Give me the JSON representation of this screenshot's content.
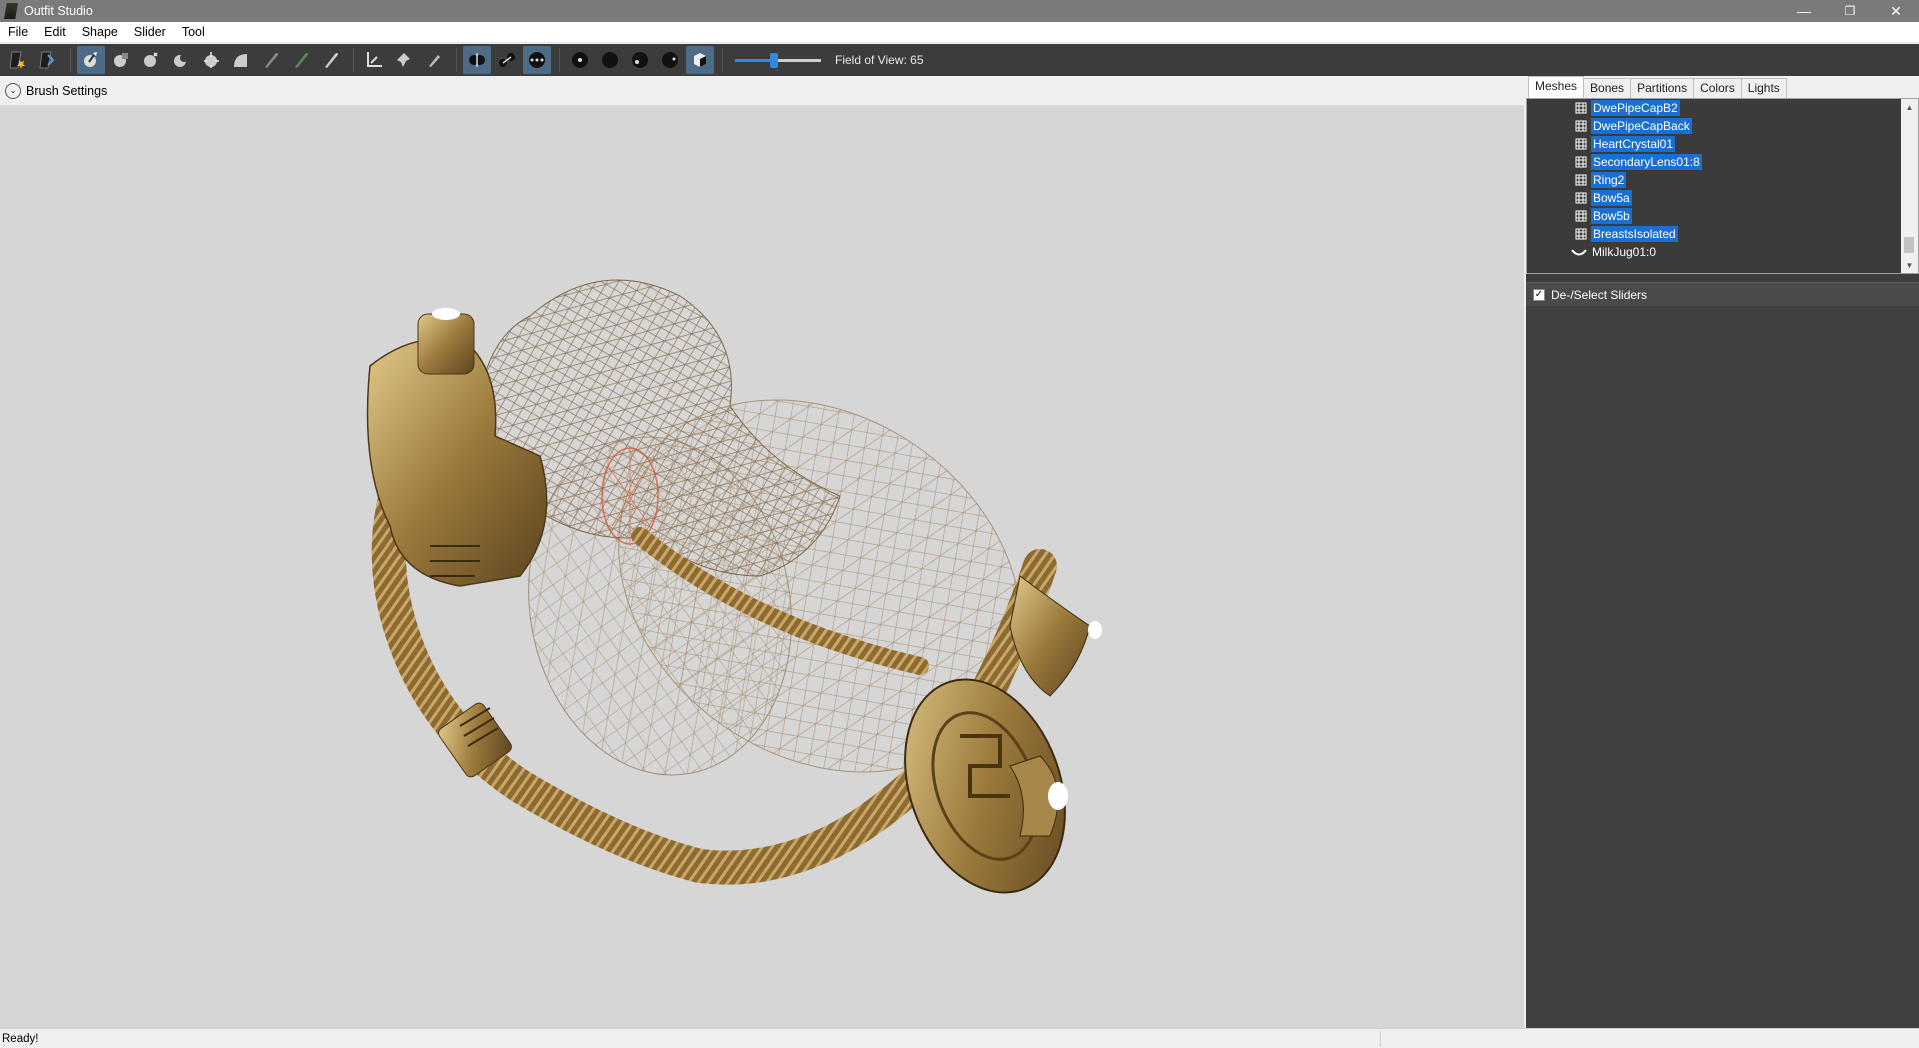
{
  "window": {
    "title": "Outfit Studio",
    "minimize_glyph": "—",
    "restore_glyph": "❐",
    "close_glyph": "✕"
  },
  "menu": [
    "File",
    "Edit",
    "Shape",
    "Slider",
    "Tool"
  ],
  "toolbar": {
    "fov_label": "Field of View: 65",
    "fov_value": 65,
    "fov_fraction": 0.45,
    "active_color": "#4d6b86"
  },
  "brush_settings": {
    "label": "Brush Settings",
    "chevron": "⌄"
  },
  "tabs": [
    "Meshes",
    "Bones",
    "Partitions",
    "Colors",
    "Lights"
  ],
  "active_tab": "Meshes",
  "mesh_tree": {
    "items": [
      {
        "name": "DwePipeCapB2",
        "selected": true,
        "icon": "mesh-grid-icon"
      },
      {
        "name": "DwePipeCapBack",
        "selected": true,
        "icon": "mesh-grid-icon"
      },
      {
        "name": "HeartCrystal01",
        "selected": true,
        "icon": "mesh-grid-icon"
      },
      {
        "name": "SecondaryLens01:8",
        "selected": true,
        "icon": "mesh-grid-icon"
      },
      {
        "name": "Ring2",
        "selected": true,
        "icon": "mesh-grid-icon"
      },
      {
        "name": "Bow5a",
        "selected": true,
        "icon": "mesh-grid-icon"
      },
      {
        "name": "Bow5b",
        "selected": true,
        "icon": "mesh-grid-icon"
      },
      {
        "name": "BreastsIsolated",
        "selected": true,
        "icon": "mesh-grid-icon"
      },
      {
        "name": "MilkJug01:0",
        "selected": false,
        "icon": "curve-icon"
      }
    ],
    "selection_color": "#1a6fd1",
    "scroll_up": "▲",
    "scroll_down": "▼"
  },
  "sliders_panel": {
    "label": "De-/Select Sliders",
    "checked": true,
    "check_glyph": "✓"
  },
  "status": {
    "text": "Ready!"
  }
}
